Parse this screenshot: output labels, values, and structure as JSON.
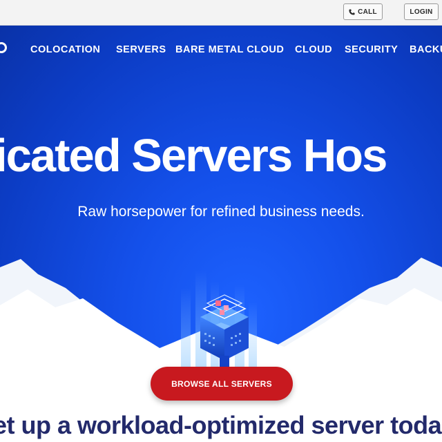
{
  "topbar": {
    "call_label": "CALL",
    "login_label": "LOGIN"
  },
  "nav": {
    "items": [
      {
        "label": "COLOCATION"
      },
      {
        "label": "SERVERS"
      },
      {
        "label": "BARE METAL CLOUD"
      },
      {
        "label": "CLOUD"
      },
      {
        "label": "SECURITY"
      },
      {
        "label": "BACKU"
      }
    ]
  },
  "hero": {
    "headline": "icated Servers Hos",
    "subline": "Raw horsepower for refined business needs.",
    "cta_label": "BROWSE ALL SERVERS",
    "tagline": "et up a workload-optimized server toda"
  },
  "colors": {
    "hero_blue": "#1450ea",
    "cta_red": "#c8191f",
    "tagline_navy": "#232a6b"
  },
  "icons": [
    "phone-icon",
    "logo-fragment",
    "server-illustration"
  ]
}
